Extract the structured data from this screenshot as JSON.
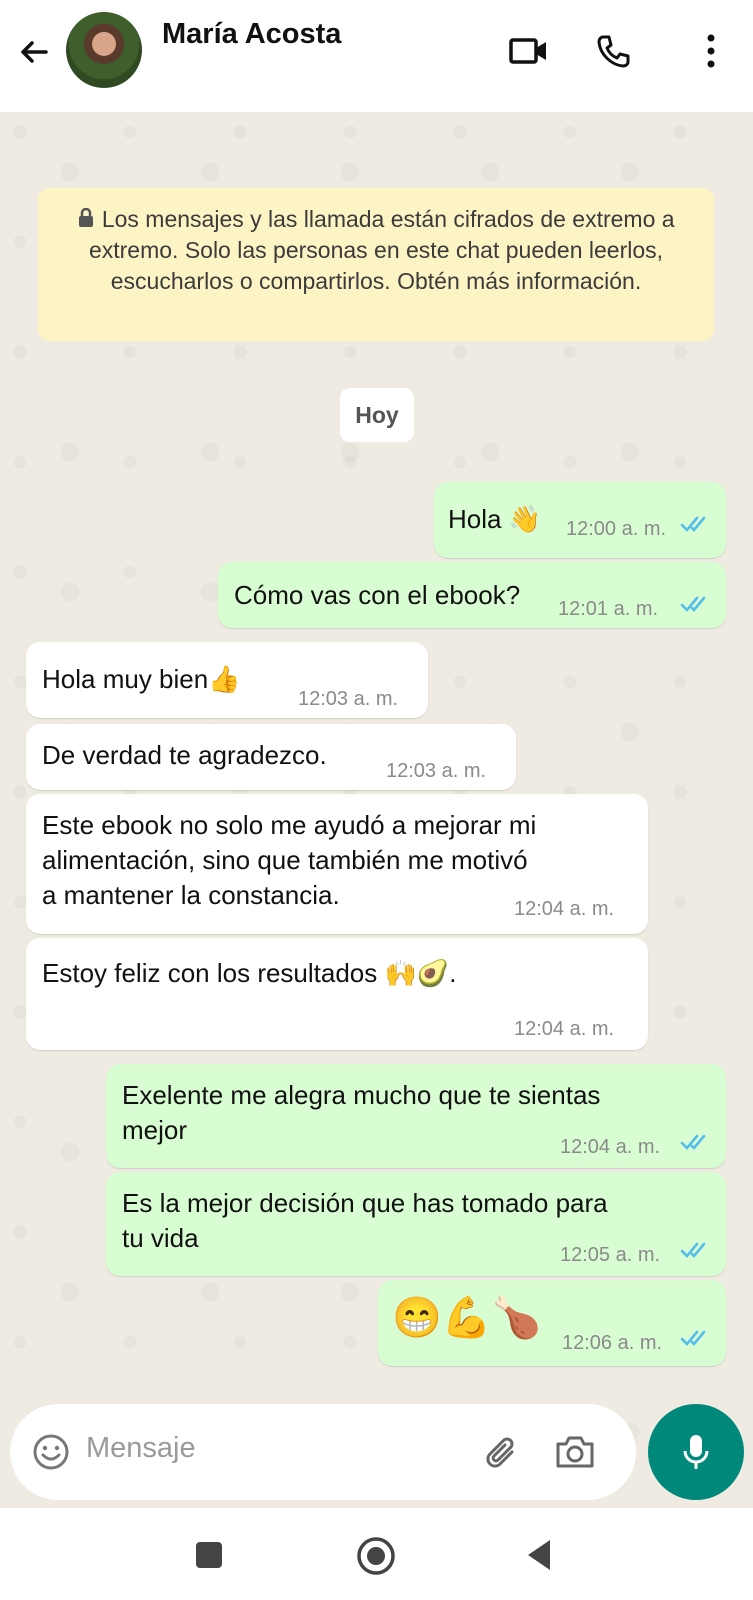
{
  "header": {
    "contact_name": "María Acosta"
  },
  "notice": {
    "text": "Los mensajes y las llamada están cifrados de extremo a extremo. Solo las personas en este chat pueden leerlos, escucharlos o compartirlos. Obtén más información."
  },
  "date_chip": "Hoy",
  "messages": [
    {
      "dir": "out",
      "text": "Hola 👋",
      "time": "12:00 a. m.",
      "read": true
    },
    {
      "dir": "out",
      "text": "Cómo vas con el ebook?",
      "time": "12:01 a. m.",
      "read": true
    },
    {
      "dir": "in",
      "text": "Hola muy bien👍",
      "time": "12:03 a. m."
    },
    {
      "dir": "in",
      "text": "De verdad te agradezco.",
      "time": "12:03 a. m."
    },
    {
      "dir": "in",
      "lines": [
        "Este ebook no solo me ayudó a mejorar mi",
        "alimentación, sino que también me motivó",
        "a mantener la constancia."
      ],
      "time": "12:04 a. m."
    },
    {
      "dir": "in",
      "text": "Estoy feliz con los resultados 🙌🥑.",
      "time": "12:04 a. m."
    },
    {
      "dir": "out",
      "lines": [
        "Exelente me alegra mucho que te sientas",
        "mejor"
      ],
      "time": "12:04 a. m.",
      "read": true
    },
    {
      "dir": "out",
      "lines": [
        "Es la mejor decisión que has tomado para",
        "tu vida"
      ],
      "time": "12:05 a. m.",
      "read": true
    },
    {
      "dir": "out",
      "text": "😁💪🍗",
      "time": "12:06 a. m.",
      "read": true
    }
  ],
  "input": {
    "placeholder": "Mensaje"
  },
  "colors": {
    "outgoing_bubble": "#d9fdd3",
    "incoming_bubble": "#ffffff",
    "read_ticks": "#53bdeb",
    "accent": "#00897b",
    "notice_bg": "#fdf4c5"
  },
  "icons": [
    "back-arrow-icon",
    "video-call-icon",
    "phone-icon",
    "more-options-icon",
    "lock-icon",
    "emoji-icon",
    "attach-icon",
    "camera-icon",
    "mic-icon",
    "nav-recents-icon",
    "nav-home-icon",
    "nav-back-icon"
  ]
}
